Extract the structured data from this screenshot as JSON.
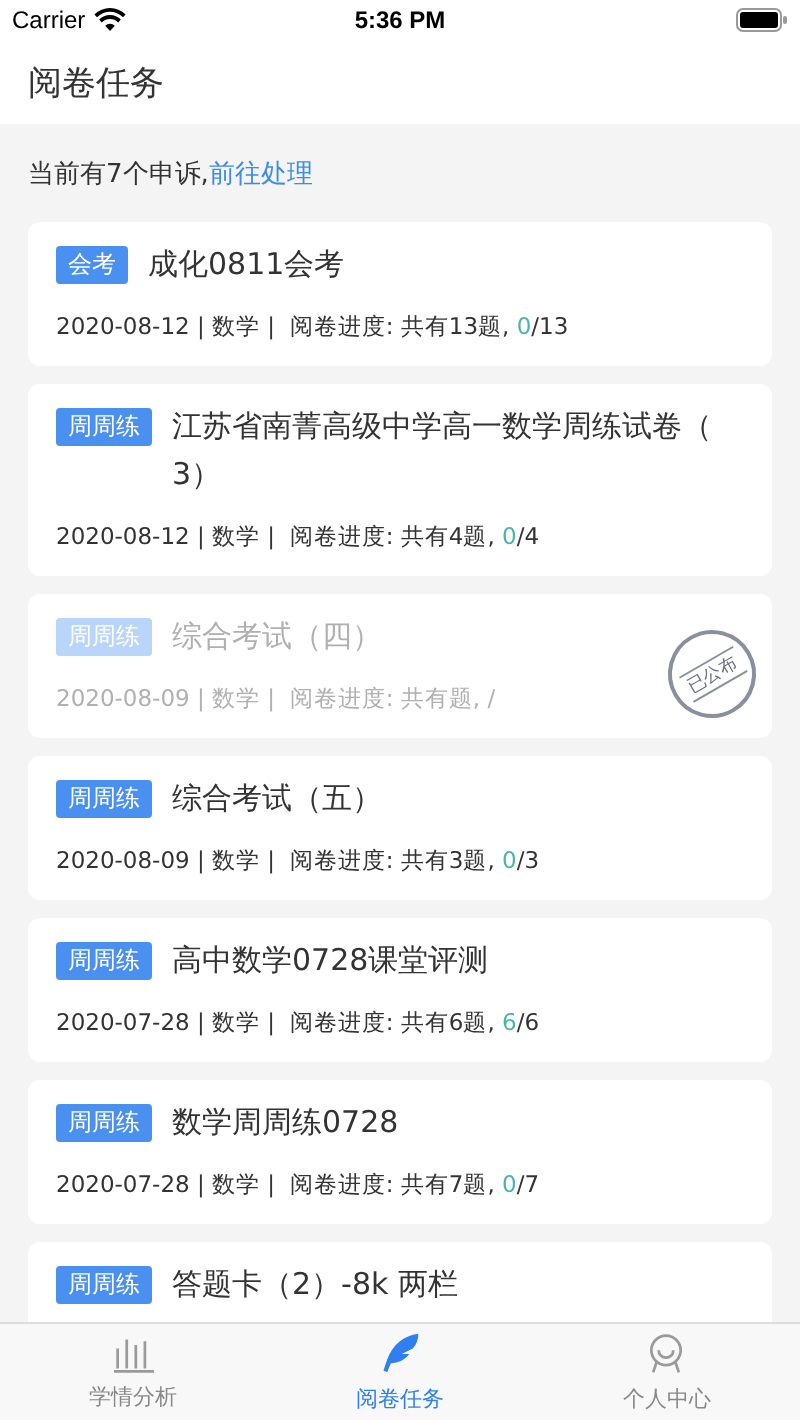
{
  "status_bar": {
    "carrier": "Carrier",
    "time": "5:36 PM"
  },
  "header": {
    "title": "阅卷任务"
  },
  "notice": {
    "text": "当前有7个申诉,",
    "link": "前往处理"
  },
  "tasks": [
    {
      "tag": "会考",
      "title": "成化0811会考",
      "meta": "2020-08-12 | 数学 |  阅卷进度: 共有13题, ",
      "graded": "0",
      "total": "/13",
      "published": false
    },
    {
      "tag": "周周练",
      "title": "江苏省南菁高级中学高一数学周练试卷（3）",
      "meta": "2020-08-12 | 数学 |  阅卷进度: 共有4题, ",
      "graded": "0",
      "total": "/4",
      "published": false
    },
    {
      "tag": "周周练",
      "title": "综合考试（四）",
      "meta": "2020-08-09 | 数学 |  阅卷进度: 共有题, ",
      "total": "/",
      "published": true,
      "stamp": "已公布"
    },
    {
      "tag": "周周练",
      "title": "综合考试（五）",
      "meta": "2020-08-09 | 数学 |  阅卷进度: 共有3题, ",
      "graded": "0",
      "total": "/3",
      "published": false
    },
    {
      "tag": "周周练",
      "title": "高中数学0728课堂评测",
      "meta": "2020-07-28 | 数学 |  阅卷进度: 共有6题, ",
      "graded": "6",
      "total": "/6",
      "published": false
    },
    {
      "tag": "周周练",
      "title": "数学周周练0728",
      "meta": "2020-07-28 | 数学 |  阅卷进度: 共有7题, ",
      "graded": "0",
      "total": "/7",
      "published": false
    },
    {
      "tag": "周周练",
      "title": "答题卡（2）-8k 两栏",
      "published": false
    }
  ],
  "tab_bar": [
    {
      "kind": "chart",
      "label": "学情分析",
      "selected": false
    },
    {
      "kind": "pen",
      "label": "阅卷任务",
      "selected": true
    },
    {
      "kind": "person",
      "label": "个人中心",
      "selected": false
    }
  ]
}
